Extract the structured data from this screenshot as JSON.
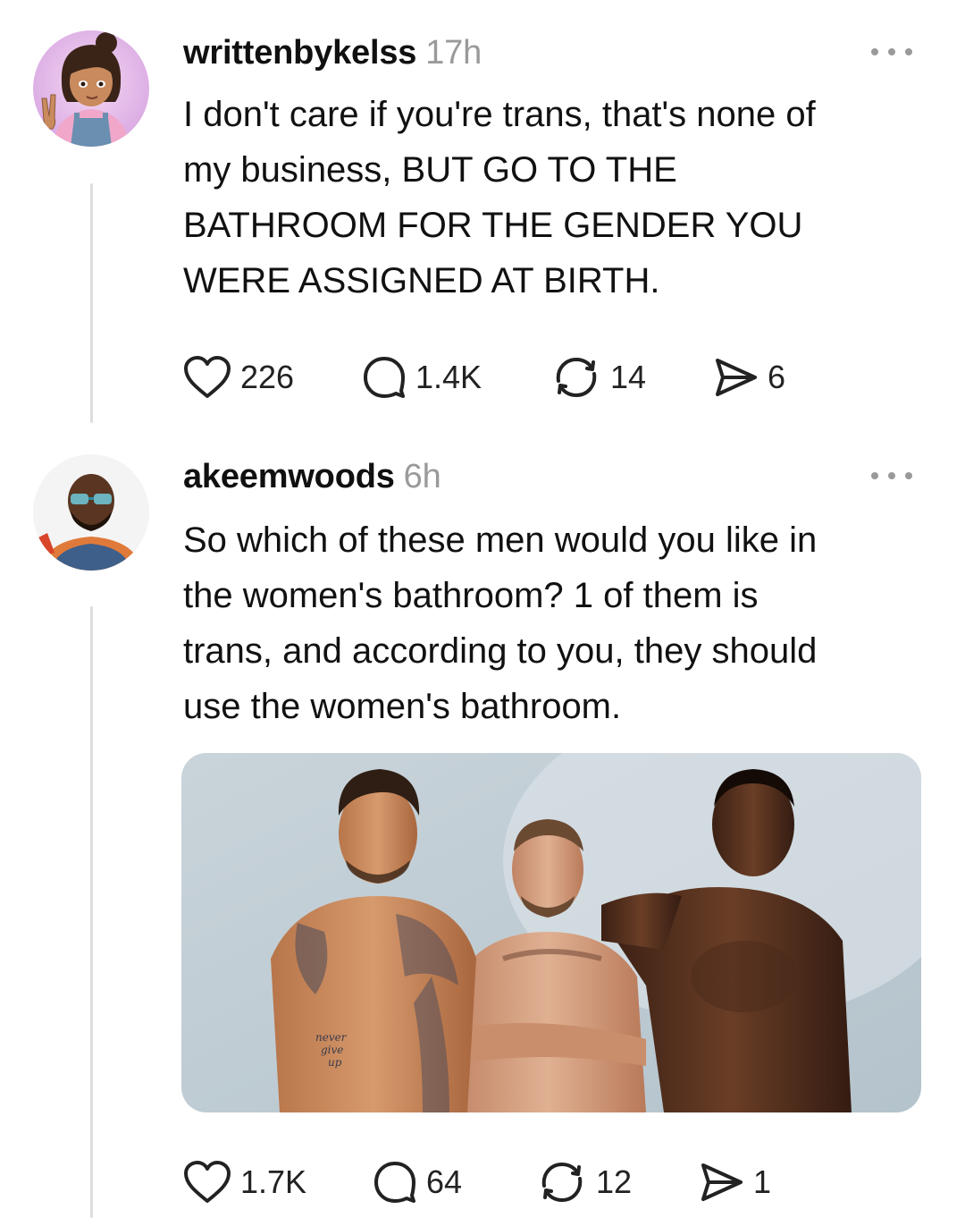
{
  "posts": [
    {
      "username": "writtenbykelss",
      "time": "17h",
      "text": "I don't care if you're trans, that's none of my business, BUT GO TO THE BATHROOM FOR THE GENDER YOU WERE ASSIGNED AT BIRTH.",
      "lines": [
        "I don't care if you're trans, that's none of",
        "my business, BUT GO TO THE",
        "BATHROOM FOR THE GENDER YOU",
        "WERE ASSIGNED AT BIRTH."
      ],
      "likes": "226",
      "replies": "1.4K",
      "reposts": "14",
      "shares": "6"
    },
    {
      "username": "akeemwoods",
      "time": "6h",
      "lines": [
        "So which of these men would you like in",
        "the women's bathroom? 1 of them is",
        "trans, and according to you, they should",
        "use the women's bathroom."
      ],
      "likes": "1.7K",
      "replies": "64",
      "reposts": "12",
      "shares": "1"
    }
  ],
  "icons": {
    "like": "heart-icon",
    "reply": "speech-bubble-icon",
    "repost": "repost-arrows-icon",
    "share": "paper-plane-icon",
    "more": "more-dots-icon"
  },
  "tattoo_text": [
    "never",
    "give",
    "up"
  ],
  "colors": {
    "timestamp": "#9a9a9a",
    "thread_line": "#dedede",
    "text": "#111111"
  }
}
